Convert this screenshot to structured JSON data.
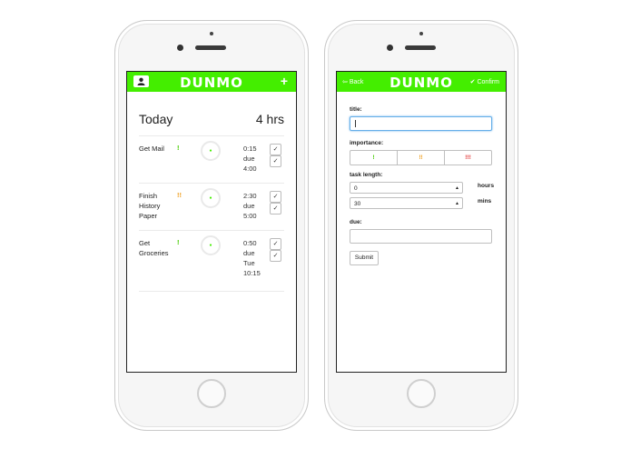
{
  "colors": {
    "accent": "#44ee00",
    "importance_low": "#44cc00",
    "importance_med": "#f0a020",
    "importance_high": "#e03030"
  },
  "left_screen": {
    "header": {
      "brand": "DUNMO",
      "profile_icon": "user-icon",
      "add_label": "+"
    },
    "summary": {
      "title": "Today",
      "total": "4 hrs"
    },
    "tasks": [
      {
        "title": "Get Mail",
        "importance": "!",
        "duration": "0:15",
        "due": "due 4:00"
      },
      {
        "title": "Finish History Paper",
        "importance": "!!",
        "duration": "2:30",
        "due": "due 5:00"
      },
      {
        "title": "Get Groceries",
        "importance": "!",
        "duration": "0:50",
        "due": "due Tue 10:15"
      }
    ]
  },
  "right_screen": {
    "header": {
      "back_label": "Back",
      "brand": "DUNMO",
      "confirm_label": "Confirm"
    },
    "form": {
      "title_label": "title:",
      "importance_label": "importance:",
      "importance_options": [
        "!",
        "!!",
        "!!!"
      ],
      "task_length_label": "task length:",
      "hours_value": "0",
      "hours_unit": "hours",
      "mins_value": "30",
      "mins_unit": "mins",
      "due_label": "due:",
      "submit_label": "Submit"
    }
  }
}
